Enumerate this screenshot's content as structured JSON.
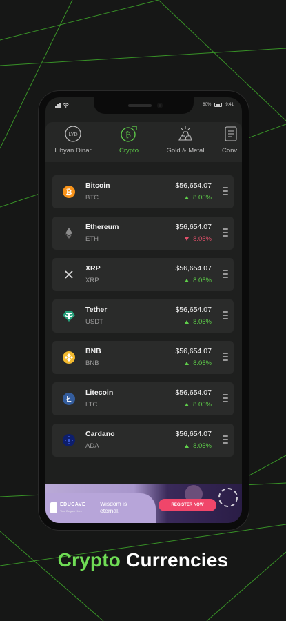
{
  "status_bar": {
    "carrier": "all",
    "battery_label": "80%",
    "time": "9:41"
  },
  "tabs": [
    {
      "label": "Libyan Dinar",
      "icon": "lyd-icon",
      "icon_text": "LYD",
      "active": false
    },
    {
      "label": "Crypto",
      "icon": "bitcoin-icon",
      "active": true
    },
    {
      "label": "Gold & Metal",
      "icon": "gold-bars-icon",
      "active": false
    },
    {
      "label": "Conv",
      "icon": "converter-icon",
      "active": false
    }
  ],
  "coins": [
    {
      "name": "Bitcoin",
      "symbol": "BTC",
      "price": "$56,654.07",
      "change": "8.05%",
      "direction": "up",
      "icon": "bitcoin-coin-icon",
      "color": "#f7931a"
    },
    {
      "name": "Ethereum",
      "symbol": "ETH",
      "price": "$56,654.07",
      "change": "8.05%",
      "direction": "down",
      "icon": "ethereum-coin-icon",
      "color": "#8c8c8c"
    },
    {
      "name": "XRP",
      "symbol": "XRP",
      "price": "$56,654.07",
      "change": "8.05%",
      "direction": "up",
      "icon": "xrp-coin-icon",
      "color": "#dcdcdc"
    },
    {
      "name": "Tether",
      "symbol": "USDT",
      "price": "$56,654.07",
      "change": "8.05%",
      "direction": "up",
      "icon": "tether-coin-icon",
      "color": "#26a17b"
    },
    {
      "name": "BNB",
      "symbol": "BNB",
      "price": "$56,654.07",
      "change": "8.05%",
      "direction": "up",
      "icon": "bnb-coin-icon",
      "color": "#f3ba2f"
    },
    {
      "name": "Litecoin",
      "symbol": "LTC",
      "price": "$56,654.07",
      "change": "8.05%",
      "direction": "up",
      "icon": "litecoin-coin-icon",
      "color": "#345d9d"
    },
    {
      "name": "Cardano",
      "symbol": "ADA",
      "price": "$56,654.07",
      "change": "8.05%",
      "direction": "up",
      "icon": "cardano-coin-icon",
      "color": "#0d1e6d"
    }
  ],
  "ad_banner": {
    "brand": "EDUCAVE",
    "brand_tagline": "Your Degree Here",
    "slogan": "Wisdom is eternal.",
    "cta": "REGISTER NOW"
  },
  "headline": {
    "accent": "Crypto",
    "rest": "Currencies"
  },
  "colors": {
    "accent_green": "#5fd04a",
    "up": "#5fd04a",
    "down": "#e0506a",
    "background": "#161716",
    "card": "#2a2b2a"
  }
}
